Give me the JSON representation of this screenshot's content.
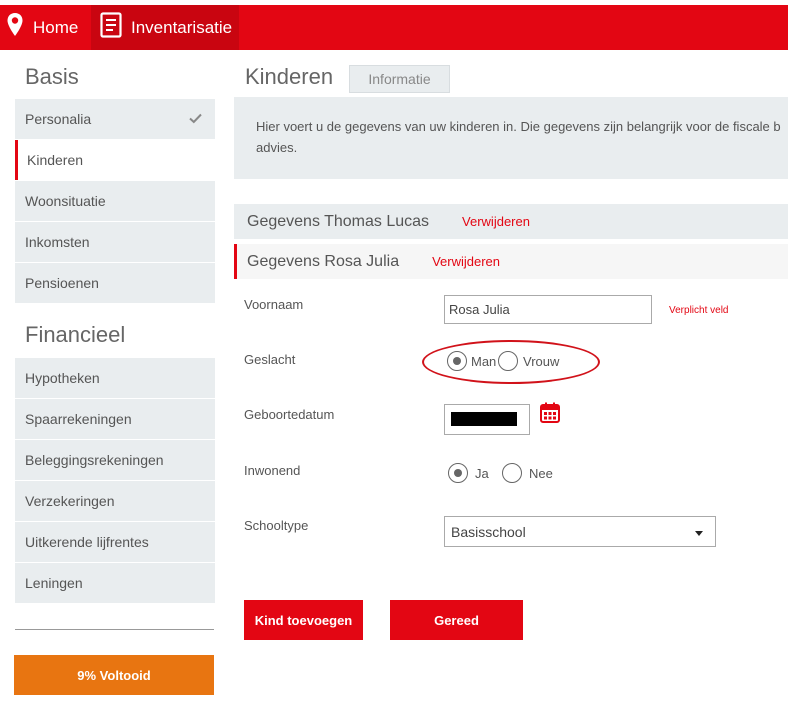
{
  "topnav": {
    "home_label": "Home",
    "inventarisatie_label": "Inventarisatie"
  },
  "sidebar": {
    "basis_heading": "Basis",
    "basis_items": [
      {
        "label": "Personalia",
        "completed": true
      },
      {
        "label": "Kinderen",
        "active": true
      },
      {
        "label": "Woonsituatie"
      },
      {
        "label": "Inkomsten"
      },
      {
        "label": "Pensioenen"
      }
    ],
    "financieel_heading": "Financieel",
    "financieel_items": [
      {
        "label": "Hypotheken"
      },
      {
        "label": "Spaarrekeningen"
      },
      {
        "label": "Beleggingsrekeningen"
      },
      {
        "label": "Verzekeringen"
      },
      {
        "label": "Uitkerende lijfrentes"
      },
      {
        "label": "Leningen"
      }
    ],
    "progress_label": "9% Voltooid",
    "progress_percent": 9
  },
  "main": {
    "title": "Kinderen",
    "info_tab_label": "Informatie",
    "info_text": "Hier voert u de gegevens van uw kinderen in. Die gegevens zijn belangrijk voor de fiscale b advies.",
    "children": [
      {
        "label": "Gegevens Thomas Lucas",
        "delete_label": "Verwijderen"
      },
      {
        "label": "Gegevens Rosa Julia",
        "delete_label": "Verwijderen"
      }
    ],
    "form": {
      "voornaam_label": "Voornaam",
      "voornaam_value": "Rosa Julia",
      "required_note": "Verplicht veld",
      "geslacht_label": "Geslacht",
      "geslacht_options": [
        "Man",
        "Vrouw"
      ],
      "geslacht_selected": "Man",
      "geboortedatum_label": "Geboortedatum",
      "inwonend_label": "Inwonend",
      "inwonend_options": [
        "Ja",
        "Nee"
      ],
      "inwonend_selected": "Ja",
      "schooltype_label": "Schooltype",
      "schooltype_value": "Basisschool"
    },
    "add_button": "Kind toevoegen",
    "done_button": "Gereed"
  },
  "colors": {
    "brand_red": "#e30613",
    "progress_orange": "#e87511",
    "panel_grey": "#e9edef"
  }
}
